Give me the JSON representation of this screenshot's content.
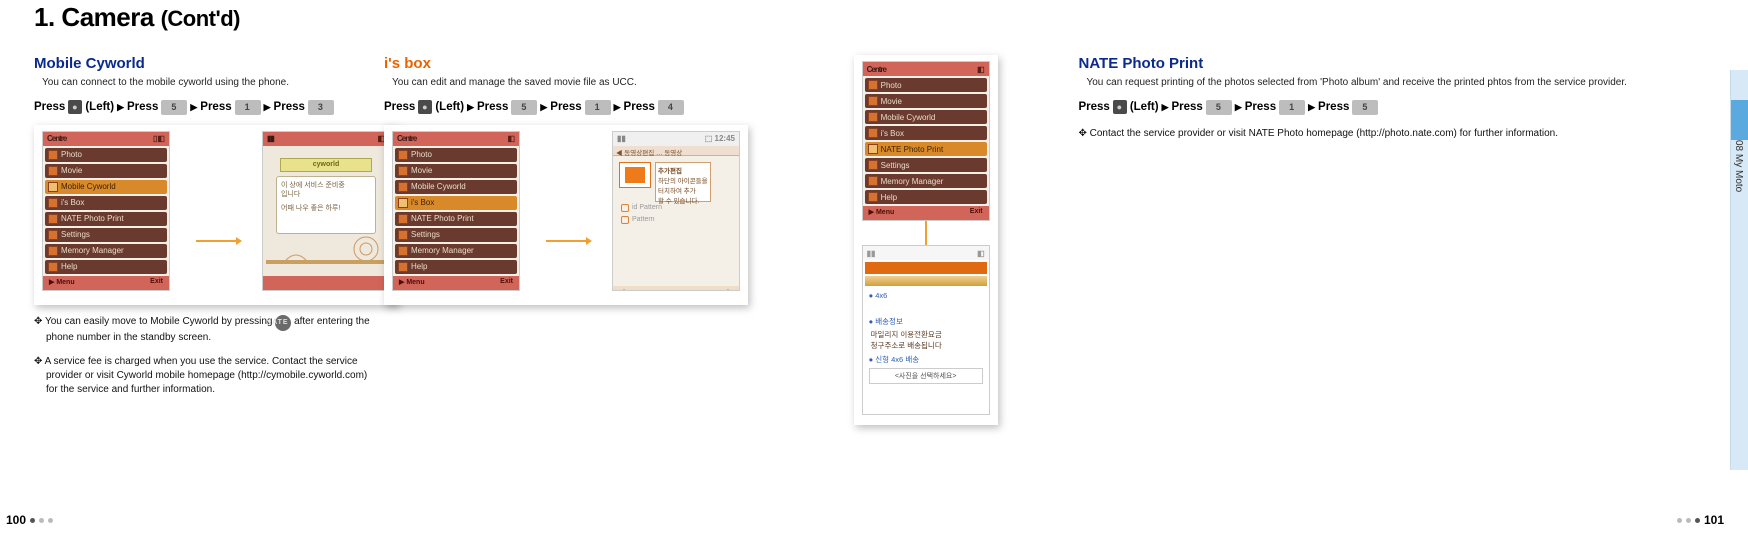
{
  "page": {
    "title_num": "1.",
    "title_main": "Camera",
    "title_cont": "(Cont'd)"
  },
  "side": {
    "label": "08 My Moto"
  },
  "footer": {
    "left_page": "100",
    "right_page": "101"
  },
  "press": {
    "press": "Press",
    "left_label": "(Left)"
  },
  "cyworld": {
    "title": "Mobile Cyworld",
    "desc": "You can connect to the mobile cyworld using the phone.",
    "keys": {
      "k0": "●",
      "k1": "5",
      "k2": "1",
      "k3": "3"
    },
    "menu": {
      "header_left": "Centre",
      "header_right": "▯◧",
      "items": [
        "Photo",
        "Movie",
        "Mobile Cyworld",
        "i's Box",
        "NATE Photo Print",
        "Settings",
        "Memory Manager",
        "Help"
      ],
      "selected_index": 2,
      "soft_left": "▶ Menu",
      "soft_mid": "",
      "soft_right": "Exit"
    },
    "popup": {
      "banner": "cyworld",
      "line1": "이 상에 서비스 준비중",
      "line2": "입니다",
      "line3": "어때 나우 좋은 하루!"
    },
    "note1_prefix": "✥ You can easily move to Mobile Cyworld by pressing ",
    "note1_suffix": " after entering the phone number in the standby screen.",
    "note1_key": "NATE",
    "note2": "✥ A service fee is charged when you use the service. Contact the service provider or visit Cyworld mobile homepage (http://cymobile.cyworld.com) for the service and further information."
  },
  "ibox": {
    "title": "i's box",
    "desc": "You can edit and manage the saved movie file as UCC.",
    "keys": {
      "k0": "●",
      "k1": "5",
      "k2": "1",
      "k3": "4"
    },
    "menu": {
      "header_left": "Centre",
      "items": [
        "Photo",
        "Movie",
        "Mobile Cyworld",
        "i's Box",
        "NATE Photo Print",
        "Settings",
        "Memory Manager",
        "Help"
      ],
      "selected_index": 3,
      "soft_left": "▶ Menu",
      "soft_right": "Exit"
    },
    "screen2": {
      "topstrip": "◀ 동영상편집 … 동영상",
      "tag_title": "추가편집",
      "tag_l1": "하단의 아이콘들을",
      "tag_l2": "터치하여 추가",
      "tag_l3": "할 수 있습니다.",
      "opt1": "id Pattern",
      "opt2": "Pattern",
      "soft_left": "◀",
      "soft_right": "▶"
    }
  },
  "nate": {
    "title": "NATE Photo Print",
    "desc": "You can request printing of the photos selected from 'Photo album' and receive the printed phtos from the service provider.",
    "keys": {
      "k0": "●",
      "k1": "5",
      "k2": "1",
      "k3": "5"
    },
    "note": "✥ Contact the service provider or visit NATE Photo homepage (http://photo.nate.com) for further information.",
    "menu": {
      "header_left": "Centre",
      "items": [
        "Photo",
        "Movie",
        "Mobile Cyworld",
        "i's Box",
        "NATE Photo Print",
        "Settings",
        "Memory Manager",
        "Help"
      ],
      "selected_index": 4,
      "soft_left": "▶ Menu",
      "soft_right": "Exit"
    },
    "screen2": {
      "item1": "● 4x6",
      "item2": "● 배송정보",
      "body1": "마일리지 이용전환요금",
      "body2": "청구주소로 배송됩니다",
      "item3": "● 신형 4x6 배송",
      "footer_box": "<사진을 선택하세요>"
    }
  }
}
